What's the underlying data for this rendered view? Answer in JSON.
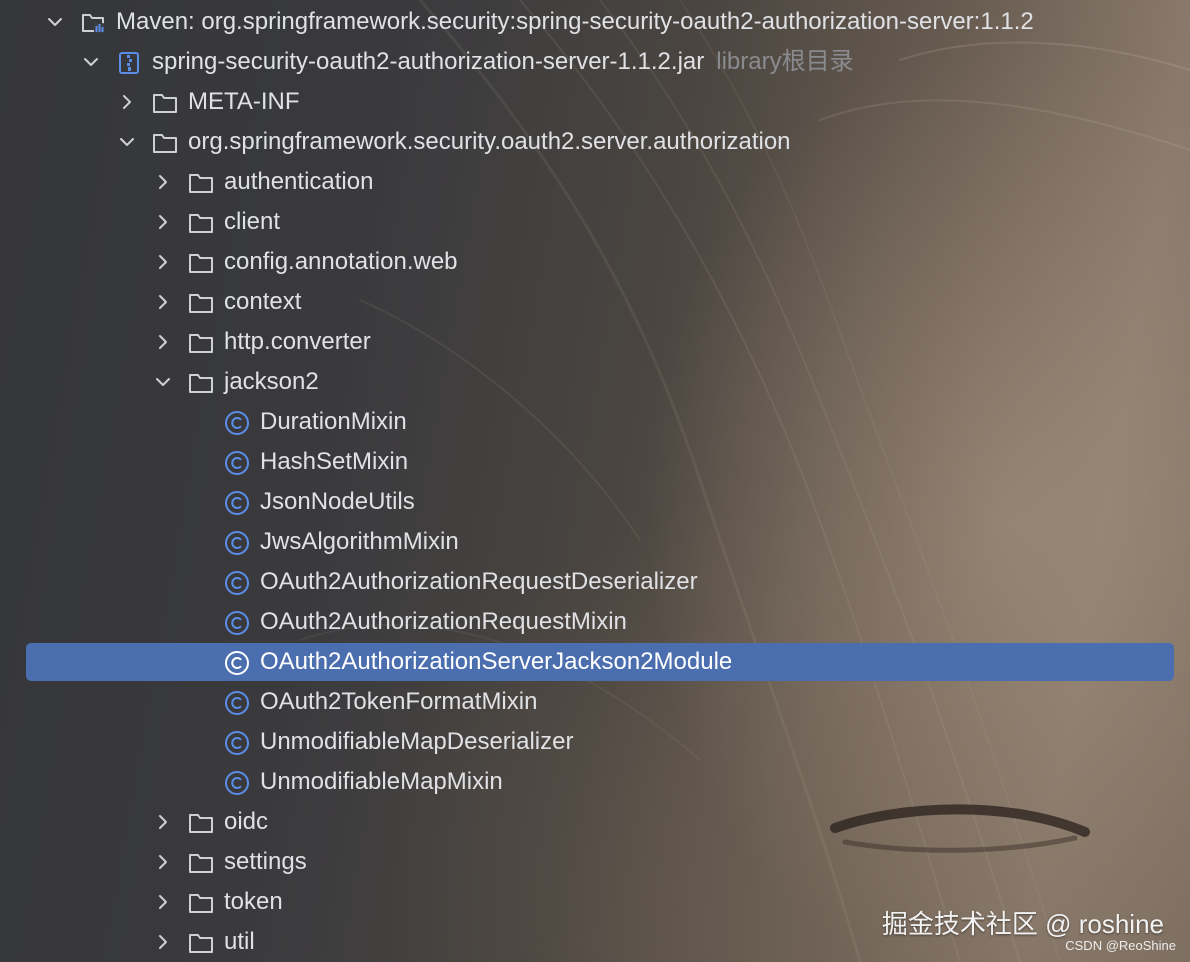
{
  "tree": {
    "root": {
      "label": "Maven: org.springframework.security:spring-security-oauth2-authorization-server:1.1.2",
      "icon": "maven-library-icon",
      "expanded": true
    },
    "jar": {
      "label": "spring-security-oauth2-authorization-server-1.1.2.jar",
      "hint": "library根目录",
      "icon": "jar-icon",
      "expanded": true
    },
    "meta_inf": {
      "label": "META-INF",
      "icon": "folder-icon",
      "expanded": false
    },
    "package": {
      "label": "org.springframework.security.oauth2.server.authorization",
      "icon": "folder-icon",
      "expanded": true
    },
    "subpackages_before": [
      {
        "label": "authentication"
      },
      {
        "label": "client"
      },
      {
        "label": "config.annotation.web"
      },
      {
        "label": "context"
      },
      {
        "label": "http.converter"
      }
    ],
    "jackson2": {
      "label": "jackson2",
      "icon": "folder-icon",
      "expanded": true
    },
    "classes": [
      {
        "label": "DurationMixin",
        "selected": false
      },
      {
        "label": "HashSetMixin",
        "selected": false
      },
      {
        "label": "JsonNodeUtils",
        "selected": false
      },
      {
        "label": "JwsAlgorithmMixin",
        "selected": false
      },
      {
        "label": "OAuth2AuthorizationRequestDeserializer",
        "selected": false
      },
      {
        "label": "OAuth2AuthorizationRequestMixin",
        "selected": false
      },
      {
        "label": "OAuth2AuthorizationServerJackson2Module",
        "selected": true
      },
      {
        "label": "OAuth2TokenFormatMixin",
        "selected": false
      },
      {
        "label": "UnmodifiableMapDeserializer",
        "selected": false
      },
      {
        "label": "UnmodifiableMapMixin",
        "selected": false
      }
    ],
    "subpackages_after": [
      {
        "label": "oidc"
      },
      {
        "label": "settings"
      },
      {
        "label": "token"
      },
      {
        "label": "util"
      }
    ]
  },
  "watermark": {
    "text": "掘金技术社区 @ roshine",
    "csdn": "CSDN @ReoShine"
  },
  "colors": {
    "text": "#dfe1e5",
    "hint": "#8a8b8f",
    "selection": "#4b6eaf",
    "class_icon": "#5a8ee8",
    "folder_outline": "#ced0d6"
  }
}
